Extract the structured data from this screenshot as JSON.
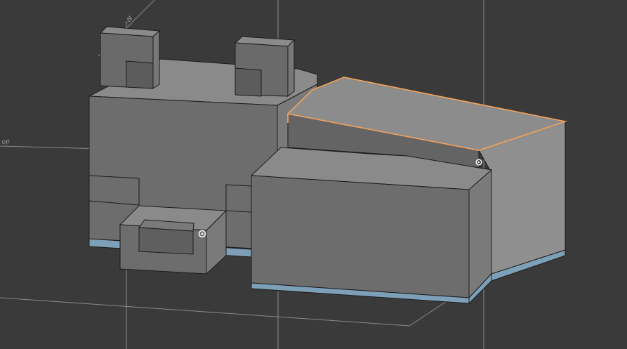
{
  "viewport": {
    "axis_label": "op",
    "annotation_label": "-/|/",
    "colors": {
      "background": "#3a3a3a",
      "guide_line": "#8a8a8a",
      "face_top": "#8a8a8a",
      "face_front": "#6d6d6d",
      "face_side": "#7c7c7c",
      "face_dark": "#5e5e5e",
      "base_strip": "#7da0b8",
      "selection": "#f2a35a",
      "edge": "#1c1c1c"
    }
  }
}
